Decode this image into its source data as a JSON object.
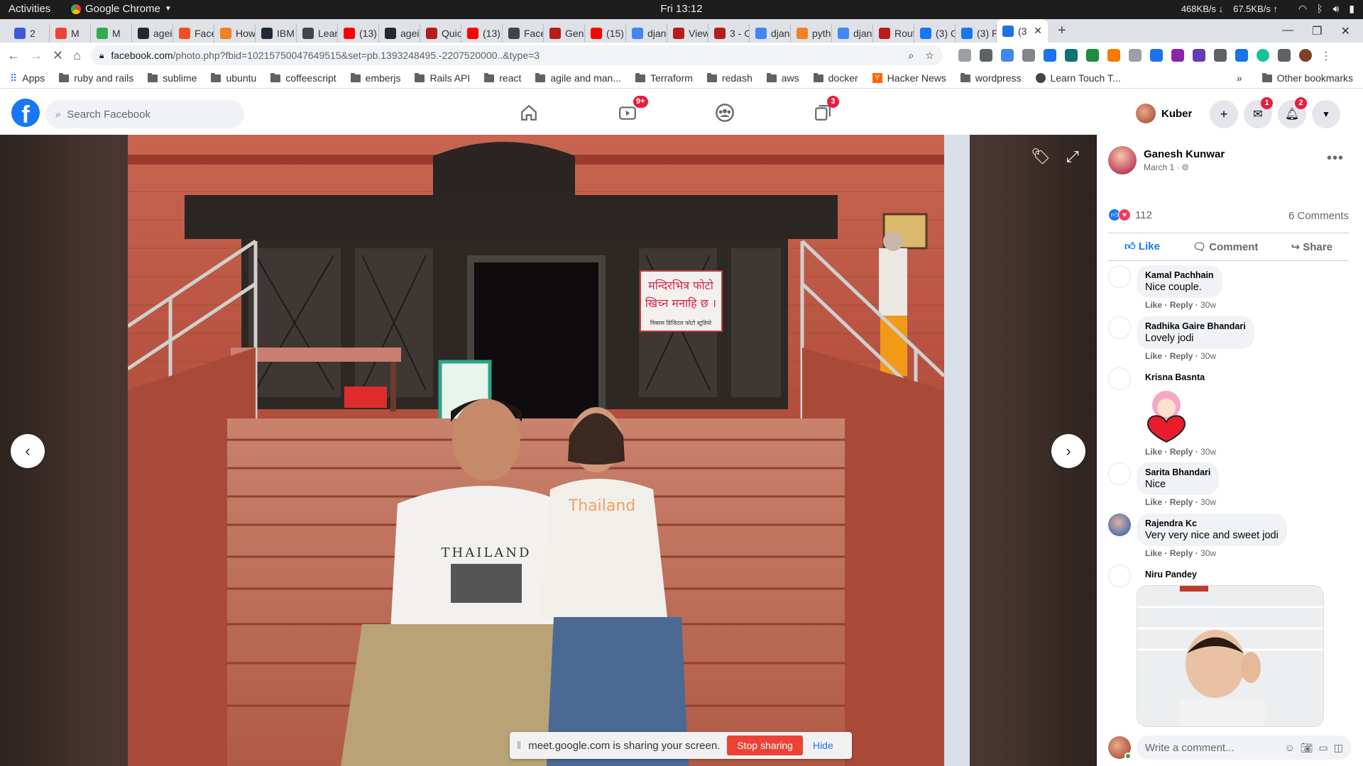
{
  "gnome": {
    "activities": "Activities",
    "app_name": "Google Chrome",
    "clock": "Fri 13:12",
    "net_down": "468KB/s",
    "net_up": "67.5KB/s"
  },
  "tabs": [
    {
      "label": "2",
      "color": "#3b5bdb"
    },
    {
      "label": "M",
      "color": "#ea4335"
    },
    {
      "label": "M",
      "color": "#34a853"
    },
    {
      "label": "agei",
      "color": "#24292f"
    },
    {
      "label": "Face",
      "color": "#f25022"
    },
    {
      "label": "How",
      "color": "#f48024"
    },
    {
      "label": "IBM",
      "color": "#1f2937"
    },
    {
      "label": "Lear",
      "color": "#444444"
    },
    {
      "label": "(13)",
      "color": "#ff0000"
    },
    {
      "label": "agei",
      "color": "#24292f"
    },
    {
      "label": "Quic",
      "color": "#b71c1c"
    },
    {
      "label": "(13)",
      "color": "#ff0000"
    },
    {
      "label": "Face",
      "color": "#444444"
    },
    {
      "label": "Gene",
      "color": "#b71c1c"
    },
    {
      "label": "(15)",
      "color": "#ff0000"
    },
    {
      "label": "djan",
      "color": "#4285f4"
    },
    {
      "label": "View",
      "color": "#b71c1c"
    },
    {
      "label": "3 - Cl",
      "color": "#b71c1c"
    },
    {
      "label": "djan",
      "color": "#4285f4"
    },
    {
      "label": "pyth",
      "color": "#f48024"
    },
    {
      "label": "djan",
      "color": "#4285f4"
    },
    {
      "label": "Rout",
      "color": "#b71c1c"
    },
    {
      "label": "(3) C",
      "color": "#1877f2"
    },
    {
      "label": "(3) Fa",
      "color": "#1877f2"
    },
    {
      "label": "(3",
      "color": "#1a73e8"
    }
  ],
  "address": {
    "host": "facebook.com",
    "path": "/photo.php?fbid=10215750047649515&set=pb.1393248495.-2207520000..&type=3"
  },
  "bookmarks": [
    {
      "label": "Apps",
      "type": "apps"
    },
    {
      "label": "ruby and rails",
      "type": "folder"
    },
    {
      "label": "sublime",
      "type": "folder"
    },
    {
      "label": "ubuntu",
      "type": "folder"
    },
    {
      "label": "coffeescript",
      "type": "folder"
    },
    {
      "label": "emberjs",
      "type": "folder"
    },
    {
      "label": "Rails API",
      "type": "folder"
    },
    {
      "label": "react",
      "type": "folder"
    },
    {
      "label": "agile and man...",
      "type": "folder"
    },
    {
      "label": "Terraform",
      "type": "folder"
    },
    {
      "label": "redash",
      "type": "folder"
    },
    {
      "label": "aws",
      "type": "folder"
    },
    {
      "label": "docker",
      "type": "folder"
    },
    {
      "label": "Hacker News",
      "type": "hn"
    },
    {
      "label": "wordpress",
      "type": "folder"
    },
    {
      "label": "Learn Touch T...",
      "type": "site"
    }
  ],
  "other_bookmarks": "Other bookmarks",
  "fb": {
    "search_placeholder": "Search Facebook",
    "video_badge": "9+",
    "pages_badge": "3",
    "profile_name": "Kuber",
    "messenger_badge": "1",
    "notif_badge": "2"
  },
  "post": {
    "author": "Ganesh Kunwar",
    "date": "March 1",
    "reactions_count": "112",
    "comments_count": "6 Comments",
    "like_label": "Like",
    "comment_label": "Comment",
    "share_label": "Share"
  },
  "comments": [
    {
      "name": "Kamal Pachhain",
      "text": "Nice couple.",
      "like": "Like",
      "reply": "Reply",
      "time": "30w"
    },
    {
      "name": "Radhika Gaire Bhandari",
      "text": "Lovely jodi",
      "like": "Like",
      "reply": "Reply",
      "time": "30w"
    },
    {
      "name": "Krisna Basnta",
      "text": "",
      "like": "Like",
      "reply": "Reply",
      "time": "30w"
    },
    {
      "name": "Sarita Bhandari",
      "text": "Nice",
      "like": "Like",
      "reply": "Reply",
      "time": "30w"
    },
    {
      "name": "Rajendra Kc",
      "text": "Very very nice and sweet jodi",
      "like": "Like",
      "reply": "Reply",
      "time": "30w"
    },
    {
      "name": "Niru Pandey",
      "text": ""
    }
  ],
  "write_placeholder": "Write a comment...",
  "photo_sign": {
    "line1": "मन्दिरभित्र फोटो",
    "line2": "खिच्न मनाहि छ ।",
    "line3": "विकास डिजिटल फोटो स्टुडियो"
  },
  "shirt_man": "THAILAND",
  "shirt_woman": "Thailand",
  "share": {
    "text": "meet.google.com is sharing your screen.",
    "stop": "Stop sharing",
    "hide": "Hide"
  }
}
